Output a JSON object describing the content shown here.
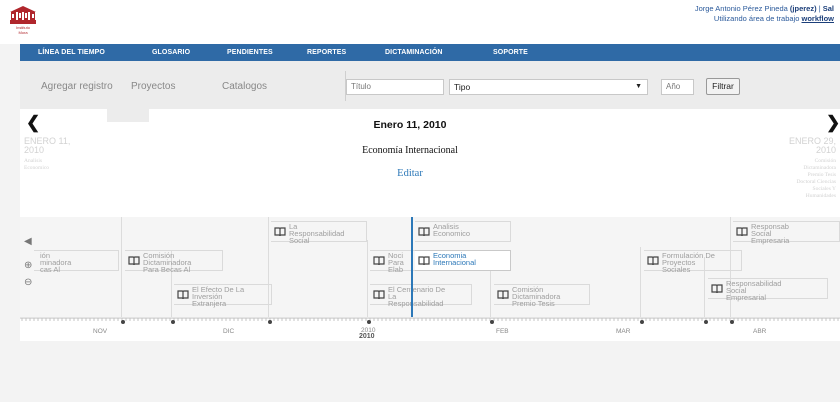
{
  "header": {
    "logo_text": "Instituto\nMora",
    "user_name": "Jorge Antonio Pérez Pineda",
    "user_handle": "(jperez)",
    "user_sep": "|",
    "user_link": "Sal",
    "workspace_prefix": "Utilizando área de trabajo",
    "workspace_name": "workflow"
  },
  "nav": {
    "items": [
      "LÍNEA DEL TIEMPO",
      "GLOSARIO",
      "PENDIENTES",
      "REPORTES",
      "DICTAMINACIÓN",
      "SOPORTE"
    ]
  },
  "toolbar": {
    "links": [
      "Agregar registro",
      "Proyectos",
      "Catalogos"
    ],
    "title_placeholder": "Título",
    "type_value": "Tipo",
    "year_placeholder": "Año",
    "filter_label": "Filtrar"
  },
  "event_panel": {
    "date": "Enero 11, 2010",
    "title": "Economía Internacional",
    "edit_label": "Editar",
    "prev_ghost": {
      "date_line1": "ENERO 11,",
      "date_line2": "2010",
      "sub_line1": "Analisis",
      "sub_line2": "Economico"
    },
    "next_ghost": {
      "date_line1": "ENERO 29,",
      "date_line2": "2010",
      "sub_lines": [
        "Comisión",
        "Dictaminadora",
        "Premio Tesis",
        "Doctoral Ciencias",
        "Sociales Y",
        "Humanidades"
      ]
    }
  },
  "timeline": {
    "events": [
      {
        "lines": [
          "ión",
          "minadora",
          "cas Al"
        ]
      },
      {
        "lines": [
          "Comisión",
          "Dictaminadora",
          "Para Becas Al"
        ]
      },
      {
        "lines": [
          "El Efecto De La",
          "Inversión",
          "Extranjera"
        ]
      },
      {
        "lines": [
          "La",
          "Responsabilidad",
          "Social"
        ]
      },
      {
        "lines": [
          "Noci",
          "Para",
          "Elab"
        ]
      },
      {
        "lines": [
          "Analisis",
          "Economico"
        ]
      },
      {
        "lines": [
          "Economia",
          "Internacional"
        ]
      },
      {
        "lines": [
          "El Centenario De",
          "La",
          "Responsabilidad"
        ]
      },
      {
        "lines": [
          "Comisión",
          "Dictaminadora",
          "Premio Tesis"
        ]
      },
      {
        "lines": [
          "Formulación De",
          "Proyectos",
          "Sociales"
        ]
      },
      {
        "lines": [
          "Responsab",
          "Social",
          "Empresaria"
        ]
      },
      {
        "lines": [
          "Responsabilidad",
          "Social",
          "Empresarial"
        ]
      }
    ],
    "axis_labels": [
      "NOV",
      "DIC",
      "2010",
      "FEB",
      "MAR",
      "ABR"
    ],
    "year_label": "2010"
  },
  "colors": {
    "nav_bg": "#2f6aa6",
    "accent": "#2c78b8",
    "logo_red": "#b0262c"
  }
}
